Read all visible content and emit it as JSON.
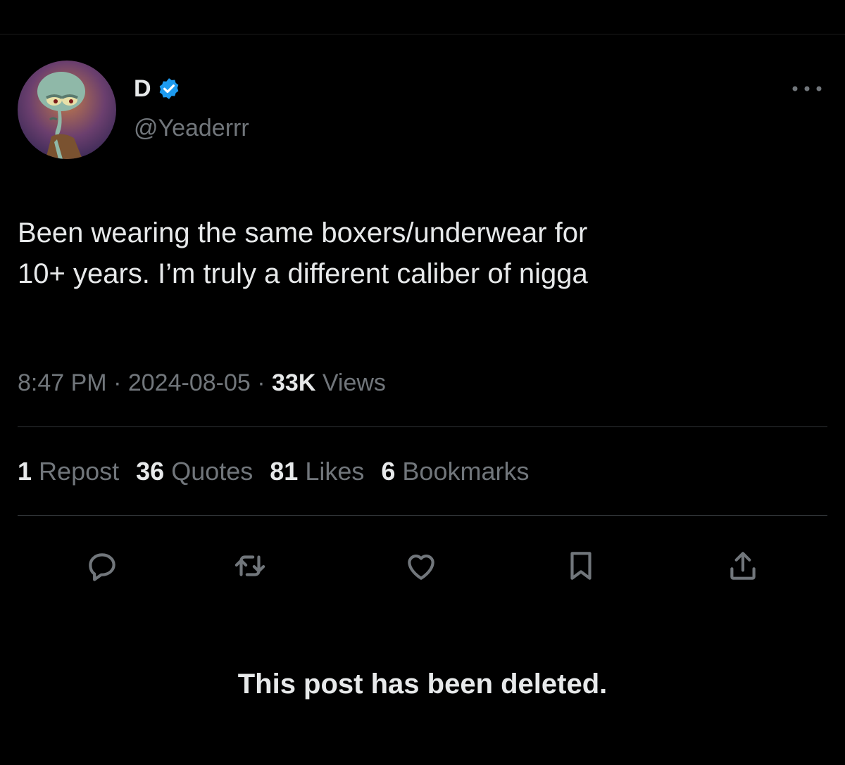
{
  "author": {
    "display_name": "D",
    "handle": "@Yeaderrr",
    "verified": true,
    "avatar_icon": "squidward-avatar"
  },
  "post": {
    "text": "Been wearing the same boxers/underwear for\n10+ years. I’m truly a different caliber of nigga",
    "time": "8:47 PM",
    "date": "2024-08-05",
    "views_count": "33K",
    "views_label": "Views",
    "separator": "·"
  },
  "stats": [
    {
      "count": "1",
      "label": "Repost"
    },
    {
      "count": "36",
      "label": "Quotes"
    },
    {
      "count": "81",
      "label": "Likes"
    },
    {
      "count": "6",
      "label": "Bookmarks"
    }
  ],
  "actions": [
    {
      "icon": "reply-icon"
    },
    {
      "icon": "repost-icon"
    },
    {
      "icon": "like-icon"
    },
    {
      "icon": "bookmark-icon"
    },
    {
      "icon": "share-icon"
    }
  ],
  "notice": {
    "deleted_text": "This post has been deleted."
  },
  "colors": {
    "background": "#000000",
    "primary_text": "#e7e9ea",
    "secondary_text": "#71767b",
    "divider": "#2f3336",
    "verified_blue": "#1d9bf0"
  }
}
